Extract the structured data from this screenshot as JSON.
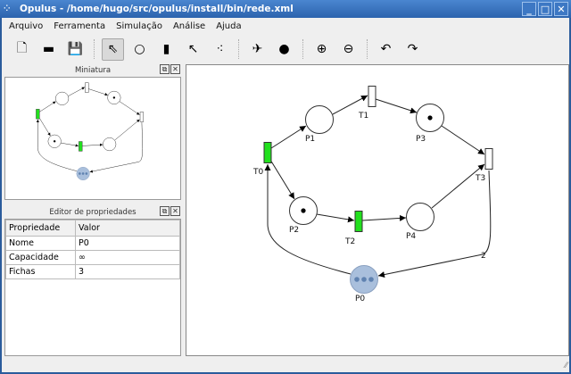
{
  "window": {
    "title": "Opulus - /home/hugo/src/opulus/install/bin/rede.xml",
    "minimize": "_",
    "maximize": "□",
    "close": "✕"
  },
  "menu": [
    "Arquivo",
    "Ferramenta",
    "Simulação",
    "Análise",
    "Ajuda"
  ],
  "toolbar": [
    {
      "name": "new-file",
      "glyph": "🗋"
    },
    {
      "name": "open-file",
      "glyph": "▬"
    },
    {
      "name": "save-file",
      "glyph": "💾"
    },
    {
      "sep": true
    },
    {
      "name": "select-pointer",
      "glyph": "⇖",
      "active": true
    },
    {
      "name": "place-tool",
      "glyph": "○"
    },
    {
      "name": "transition-tool",
      "glyph": "▮"
    },
    {
      "name": "arc-tool",
      "glyph": "↖"
    },
    {
      "name": "token-tool",
      "glyph": "⁖"
    },
    {
      "sep": true
    },
    {
      "name": "fire",
      "glyph": "✈"
    },
    {
      "name": "random-fire",
      "glyph": "●"
    },
    {
      "sep": true
    },
    {
      "name": "zoom-in",
      "glyph": "⊕"
    },
    {
      "name": "zoom-out",
      "glyph": "⊖"
    },
    {
      "sep": true
    },
    {
      "name": "undo",
      "glyph": "↶"
    },
    {
      "name": "redo",
      "glyph": "↷"
    }
  ],
  "miniature": {
    "title": "Miniatura"
  },
  "properties": {
    "title": "Editor de propriedades",
    "headers": [
      "Propriedade",
      "Valor"
    ],
    "rows": [
      [
        "Nome",
        "P0"
      ],
      [
        "Capacidade",
        "∞"
      ],
      [
        "Fichas",
        "3"
      ]
    ]
  },
  "net": {
    "places": [
      {
        "id": "P0",
        "tokens": 3,
        "selected": true
      },
      {
        "id": "P1",
        "tokens": 0
      },
      {
        "id": "P2",
        "tokens": 1
      },
      {
        "id": "P3",
        "tokens": 1
      },
      {
        "id": "P4",
        "tokens": 0
      }
    ],
    "transitions": [
      {
        "id": "T0",
        "enabled": true
      },
      {
        "id": "T1",
        "enabled": false
      },
      {
        "id": "T2",
        "enabled": true
      },
      {
        "id": "T3",
        "enabled": false
      }
    ],
    "arc_weight_label": "2",
    "colors": {
      "enabled": "#22e01e",
      "disabled": "#ffffff",
      "selected": "#a9bfdc",
      "token_selected": "#5f82b0"
    }
  }
}
